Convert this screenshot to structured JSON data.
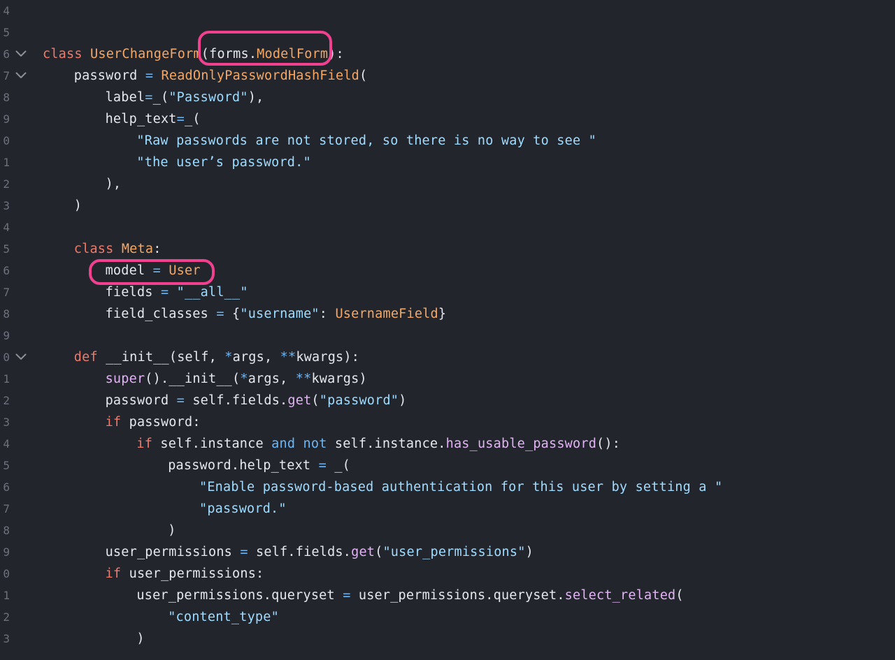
{
  "editor": {
    "lines": [
      {
        "num": "4",
        "fold": false,
        "indent": 0,
        "tokens": []
      },
      {
        "num": "5",
        "fold": false,
        "indent": 0,
        "tokens": []
      },
      {
        "num": "6",
        "fold": true,
        "indent": 0,
        "tokens": [
          {
            "t": "class",
            "c": "kw"
          },
          {
            "t": " ",
            "c": "p"
          },
          {
            "t": "UserChangeForm",
            "c": "cls"
          },
          {
            "t": "(",
            "c": "p"
          },
          {
            "t": "forms",
            "c": "var"
          },
          {
            "t": ".",
            "c": "p"
          },
          {
            "t": "ModelForm",
            "c": "cls"
          },
          {
            "t": "):",
            "c": "p"
          }
        ]
      },
      {
        "num": "7",
        "fold": true,
        "indent": 4,
        "tokens": [
          {
            "t": "password",
            "c": "var"
          },
          {
            "t": " ",
            "c": "p"
          },
          {
            "t": "=",
            "c": "op"
          },
          {
            "t": " ",
            "c": "p"
          },
          {
            "t": "ReadOnlyPasswordHashField",
            "c": "cls"
          },
          {
            "t": "(",
            "c": "p"
          }
        ]
      },
      {
        "num": "8",
        "fold": false,
        "indent": 8,
        "tokens": [
          {
            "t": "label",
            "c": "var"
          },
          {
            "t": "=",
            "c": "op"
          },
          {
            "t": "_",
            "c": "var"
          },
          {
            "t": "(",
            "c": "p"
          },
          {
            "t": "\"Password\"",
            "c": "str"
          },
          {
            "t": "),",
            "c": "p"
          }
        ]
      },
      {
        "num": "9",
        "fold": false,
        "indent": 8,
        "tokens": [
          {
            "t": "help_text",
            "c": "var"
          },
          {
            "t": "=",
            "c": "op"
          },
          {
            "t": "_",
            "c": "var"
          },
          {
            "t": "(",
            "c": "p"
          }
        ]
      },
      {
        "num": "0",
        "fold": false,
        "indent": 12,
        "tokens": [
          {
            "t": "\"Raw passwords are not stored, so there is no way to see \"",
            "c": "str"
          }
        ]
      },
      {
        "num": "1",
        "fold": false,
        "indent": 12,
        "tokens": [
          {
            "t": "\"the user’s password.\"",
            "c": "str"
          }
        ]
      },
      {
        "num": "2",
        "fold": false,
        "indent": 8,
        "tokens": [
          {
            "t": "),",
            "c": "p"
          }
        ]
      },
      {
        "num": "3",
        "fold": false,
        "indent": 4,
        "tokens": [
          {
            "t": ")",
            "c": "p"
          }
        ]
      },
      {
        "num": "4",
        "fold": false,
        "indent": 0,
        "tokens": []
      },
      {
        "num": "5",
        "fold": false,
        "indent": 4,
        "tokens": [
          {
            "t": "class",
            "c": "kw"
          },
          {
            "t": " ",
            "c": "p"
          },
          {
            "t": "Meta",
            "c": "cls"
          },
          {
            "t": ":",
            "c": "p"
          }
        ]
      },
      {
        "num": "6",
        "fold": false,
        "indent": 8,
        "tokens": [
          {
            "t": "model",
            "c": "var"
          },
          {
            "t": " ",
            "c": "p"
          },
          {
            "t": "=",
            "c": "op"
          },
          {
            "t": " ",
            "c": "p"
          },
          {
            "t": "User",
            "c": "cls"
          }
        ]
      },
      {
        "num": "7",
        "fold": false,
        "indent": 8,
        "tokens": [
          {
            "t": "fields",
            "c": "var"
          },
          {
            "t": " ",
            "c": "p"
          },
          {
            "t": "=",
            "c": "op"
          },
          {
            "t": " ",
            "c": "p"
          },
          {
            "t": "\"__all__\"",
            "c": "str"
          }
        ]
      },
      {
        "num": "8",
        "fold": false,
        "indent": 8,
        "tokens": [
          {
            "t": "field_classes",
            "c": "var"
          },
          {
            "t": " ",
            "c": "p"
          },
          {
            "t": "=",
            "c": "op"
          },
          {
            "t": " ",
            "c": "p"
          },
          {
            "t": "{",
            "c": "p"
          },
          {
            "t": "\"username\"",
            "c": "str"
          },
          {
            "t": ": ",
            "c": "p"
          },
          {
            "t": "UsernameField",
            "c": "cls"
          },
          {
            "t": "}",
            "c": "p"
          }
        ]
      },
      {
        "num": "9",
        "fold": false,
        "indent": 0,
        "tokens": []
      },
      {
        "num": "0",
        "fold": true,
        "indent": 4,
        "tokens": [
          {
            "t": "def",
            "c": "kw"
          },
          {
            "t": " ",
            "c": "p"
          },
          {
            "t": "__init__",
            "c": "var"
          },
          {
            "t": "(",
            "c": "p"
          },
          {
            "t": "self",
            "c": "var"
          },
          {
            "t": ", ",
            "c": "p"
          },
          {
            "t": "*",
            "c": "op"
          },
          {
            "t": "args",
            "c": "var"
          },
          {
            "t": ", ",
            "c": "p"
          },
          {
            "t": "**",
            "c": "op"
          },
          {
            "t": "kwargs",
            "c": "var"
          },
          {
            "t": "):",
            "c": "p"
          }
        ]
      },
      {
        "num": "1",
        "fold": false,
        "indent": 8,
        "tokens": [
          {
            "t": "super",
            "c": "fn"
          },
          {
            "t": "().",
            "c": "p"
          },
          {
            "t": "__init__",
            "c": "var"
          },
          {
            "t": "(",
            "c": "p"
          },
          {
            "t": "*",
            "c": "op"
          },
          {
            "t": "args",
            "c": "var"
          },
          {
            "t": ", ",
            "c": "p"
          },
          {
            "t": "**",
            "c": "op"
          },
          {
            "t": "kwargs",
            "c": "var"
          },
          {
            "t": ")",
            "c": "p"
          }
        ]
      },
      {
        "num": "2",
        "fold": false,
        "indent": 8,
        "tokens": [
          {
            "t": "password",
            "c": "var"
          },
          {
            "t": " ",
            "c": "p"
          },
          {
            "t": "=",
            "c": "op"
          },
          {
            "t": " self.fields.",
            "c": "var"
          },
          {
            "t": "get",
            "c": "fn"
          },
          {
            "t": "(",
            "c": "p"
          },
          {
            "t": "\"password\"",
            "c": "str"
          },
          {
            "t": ")",
            "c": "p"
          }
        ]
      },
      {
        "num": "3",
        "fold": false,
        "indent": 8,
        "tokens": [
          {
            "t": "if",
            "c": "kw"
          },
          {
            "t": " password:",
            "c": "var"
          }
        ]
      },
      {
        "num": "4",
        "fold": false,
        "indent": 12,
        "tokens": [
          {
            "t": "if",
            "c": "kw"
          },
          {
            "t": " self.instance ",
            "c": "var"
          },
          {
            "t": "and",
            "c": "op"
          },
          {
            "t": " ",
            "c": "p"
          },
          {
            "t": "not",
            "c": "op"
          },
          {
            "t": " self.instance.",
            "c": "var"
          },
          {
            "t": "has_usable_password",
            "c": "fn"
          },
          {
            "t": "():",
            "c": "p"
          }
        ]
      },
      {
        "num": "5",
        "fold": false,
        "indent": 16,
        "tokens": [
          {
            "t": "password.help_text",
            "c": "var"
          },
          {
            "t": " ",
            "c": "p"
          },
          {
            "t": "=",
            "c": "op"
          },
          {
            "t": " ",
            "c": "p"
          },
          {
            "t": "_",
            "c": "var"
          },
          {
            "t": "(",
            "c": "p"
          }
        ]
      },
      {
        "num": "6",
        "fold": false,
        "indent": 20,
        "tokens": [
          {
            "t": "\"Enable password-based authentication for this user by setting a \"",
            "c": "str"
          }
        ]
      },
      {
        "num": "7",
        "fold": false,
        "indent": 20,
        "tokens": [
          {
            "t": "\"password.\"",
            "c": "str"
          }
        ]
      },
      {
        "num": "8",
        "fold": false,
        "indent": 16,
        "tokens": [
          {
            "t": ")",
            "c": "p"
          }
        ]
      },
      {
        "num": "9",
        "fold": false,
        "indent": 8,
        "tokens": [
          {
            "t": "user_permissions",
            "c": "var"
          },
          {
            "t": " ",
            "c": "p"
          },
          {
            "t": "=",
            "c": "op"
          },
          {
            "t": " self.fields.",
            "c": "var"
          },
          {
            "t": "get",
            "c": "fn"
          },
          {
            "t": "(",
            "c": "p"
          },
          {
            "t": "\"user_permissions\"",
            "c": "str"
          },
          {
            "t": ")",
            "c": "p"
          }
        ]
      },
      {
        "num": "0",
        "fold": false,
        "indent": 8,
        "tokens": [
          {
            "t": "if",
            "c": "kw"
          },
          {
            "t": " user_permissions:",
            "c": "var"
          }
        ]
      },
      {
        "num": "1",
        "fold": false,
        "indent": 12,
        "tokens": [
          {
            "t": "user_permissions.queryset",
            "c": "var"
          },
          {
            "t": " ",
            "c": "p"
          },
          {
            "t": "=",
            "c": "op"
          },
          {
            "t": " user_permissions.queryset.",
            "c": "var"
          },
          {
            "t": "select_related",
            "c": "fn"
          },
          {
            "t": "(",
            "c": "p"
          }
        ]
      },
      {
        "num": "2",
        "fold": false,
        "indent": 16,
        "tokens": [
          {
            "t": "\"content_type\"",
            "c": "str"
          }
        ]
      },
      {
        "num": "3",
        "fold": false,
        "indent": 12,
        "tokens": [
          {
            "t": ")",
            "c": "p"
          }
        ]
      }
    ]
  },
  "colors": {
    "background": "#22252c",
    "keyword": "#ef7a6a",
    "class_name": "#f5a764",
    "string": "#9fdcff",
    "function": "#e2b4f5",
    "operator": "#6bb6f5",
    "text": "#e6e8ee",
    "line_number": "#6d717b",
    "highlight_box": "#f0418f"
  },
  "icons": {
    "fold": "chevron-down-icon"
  }
}
